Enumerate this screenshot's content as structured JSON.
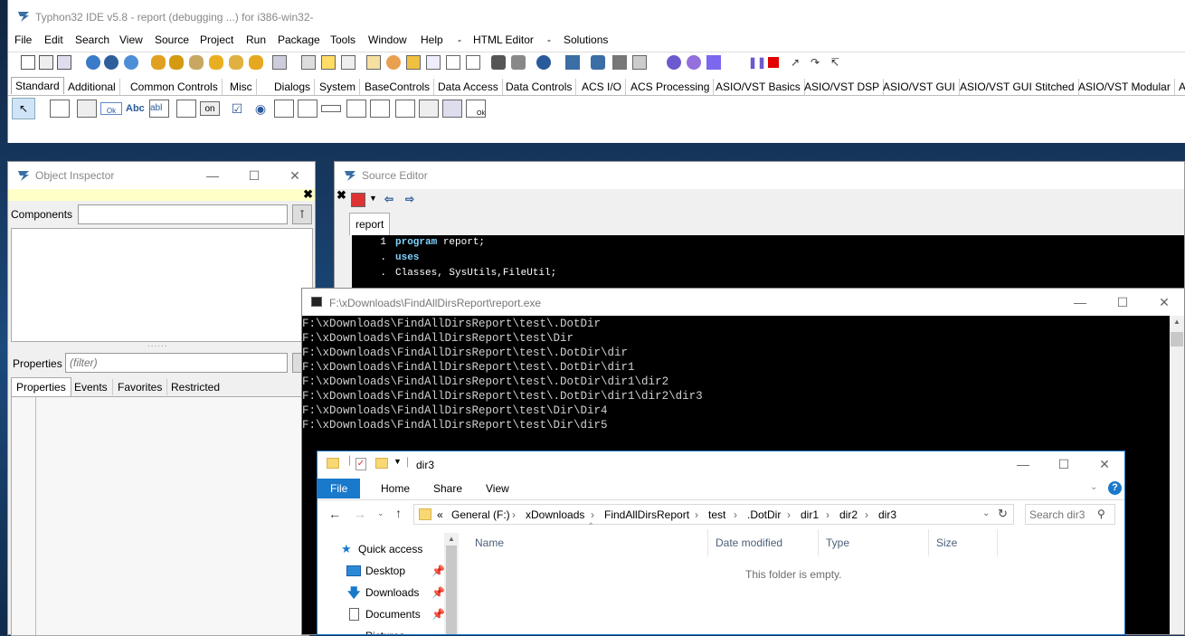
{
  "ide": {
    "title": "Typhon32 IDE v5.8 - report (debugging ...) for i386-win32-",
    "menu": [
      "File",
      "Edit",
      "Search",
      "View",
      "Source",
      "Project",
      "Run",
      "Package",
      "Tools",
      "Window",
      "Help",
      "-",
      "HTML Editor",
      "-",
      "Solutions"
    ],
    "palette_tabs": [
      "Standard",
      "Additional",
      "Common Controls",
      "Misc",
      "Dialogs",
      "System",
      "BaseControls",
      "Data Access",
      "Data Controls",
      "ACS I/O",
      "ACS Processing",
      "ASIO/VST Basics",
      "ASIO/VST DSP",
      "ASIO/VST GUI",
      "ASIO/VST GUI Stitched",
      "ASIO/VST Modular",
      "A"
    ],
    "palette_labels": {
      "ok": "Ok",
      "abc": "Abc",
      "abl": "abl",
      "on": "on",
      "ok2": "Ok"
    }
  },
  "object_inspector": {
    "title": "Object Inspector",
    "components_label": "Components",
    "properties_label": "Properties",
    "filter_placeholder": "(filter)",
    "grip": "......",
    "tabs": [
      "Properties",
      "Events",
      "Favorites",
      "Restricted"
    ]
  },
  "source_editor": {
    "title": "Source Editor",
    "tab": "report",
    "lines": [
      {
        "num": "1",
        "kw": "program",
        "text": " report;"
      },
      {
        "num": ".",
        "kw": "uses",
        "text": ""
      },
      {
        "num": ".",
        "kw": "",
        "text": "Classes, SysUtils,FileUtil;"
      }
    ]
  },
  "console": {
    "title": "F:\\xDownloads\\FindAllDirsReport\\report.exe",
    "lines": [
      "F:\\xDownloads\\FindAllDirsReport\\test\\.DotDir",
      "F:\\xDownloads\\FindAllDirsReport\\test\\Dir",
      "F:\\xDownloads\\FindAllDirsReport\\test\\.DotDir\\dir",
      "F:\\xDownloads\\FindAllDirsReport\\test\\.DotDir\\dir1",
      "F:\\xDownloads\\FindAllDirsReport\\test\\.DotDir\\dir1\\dir2",
      "F:\\xDownloads\\FindAllDirsReport\\test\\.DotDir\\dir1\\dir2\\dir3",
      "F:\\xDownloads\\FindAllDirsReport\\test\\Dir\\Dir4",
      "F:\\xDownloads\\FindAllDirsReport\\test\\Dir\\dir5"
    ]
  },
  "explorer": {
    "title": "dir3",
    "ribbon_tabs": [
      "File",
      "Home",
      "Share",
      "View"
    ],
    "breadcrumb": [
      "«",
      "General (F:)",
      "xDownloads",
      "FindAllDirsReport",
      "test",
      ".DotDir",
      "dir1",
      "dir2",
      "dir3"
    ],
    "search_placeholder": "Search dir3",
    "nav": [
      "Quick access",
      "Desktop",
      "Downloads",
      "Documents",
      "Pictures"
    ],
    "columns": [
      "Name",
      "Date modified",
      "Type",
      "Size"
    ],
    "empty_message": "This folder is empty."
  }
}
